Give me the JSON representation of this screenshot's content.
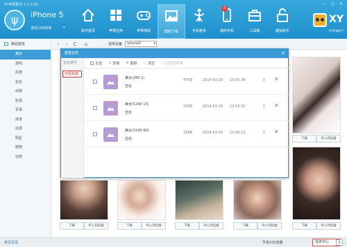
{
  "app": {
    "title": "XY苹果助手 1.1.2.56"
  },
  "window_controls": [
    "—",
    "□",
    "×"
  ],
  "device": {
    "name": "iPhone 5",
    "connection": "通过USB连接",
    "dropdown": "▾"
  },
  "nav": [
    {
      "label": "软件首页",
      "icon": "home-icon"
    },
    {
      "label": "苹果应用",
      "icon": "apps-icon"
    },
    {
      "label": "苹果游戏",
      "icon": "gamepad-icon"
    },
    {
      "label": "壁纸下载",
      "icon": "wallpaper-icon",
      "active": true
    },
    {
      "label": "手机瘦身",
      "icon": "slim-icon"
    },
    {
      "label": "我的手机",
      "icon": "phone-icon",
      "badge": "3"
    },
    {
      "label": "工具箱",
      "icon": "toolbox-icon"
    },
    {
      "label": "越狱助手",
      "icon": "jailbreak-icon"
    }
  ],
  "brand": {
    "name": "XY",
    "sub": "XY苹果助手"
  },
  "sidebar": {
    "header": "精品壁纸",
    "items": [
      "美女",
      "游戏",
      "风景",
      "名车",
      "动物",
      "影视",
      "军事",
      "体育",
      "动漫",
      "明星",
      "植物",
      "创意"
    ]
  },
  "toolbar": {
    "back": "‹",
    "forward": "›",
    "refresh": "C",
    "home": "⌂",
    "device_label": "选择设备",
    "device_value": "iphone5"
  },
  "wallpaper_actions": {
    "download": "下载",
    "import": "导入到设备"
  },
  "statusbar": {
    "feedback": "意见反馈",
    "saving": "节省100流量",
    "task_center": "任务中心",
    "task_count": "0"
  },
  "dialog": {
    "title": "壁纸任务",
    "close": "×",
    "tabs": [
      "正在进行",
      "已经完成"
    ],
    "tools": {
      "select_all": "全选",
      "install": "安装",
      "delete": "删除",
      "clear": "清空",
      "open_folder": "打开文件夹"
    },
    "rows": [
      {
        "name": "美女(280  1)",
        "type": "壁纸",
        "size": "47KB",
        "date": "2014-03-20",
        "time": "15:03:38"
      },
      {
        "name": "美女(5240  15)",
        "type": "壁纸",
        "size": "22KB",
        "date": "2014-03-20",
        "time": "12:53:32"
      },
      {
        "name": "美女(5240  80)",
        "type": "壁纸",
        "size": "23KB",
        "date": "2014-03-20",
        "time": "12:46:12"
      }
    ]
  }
}
